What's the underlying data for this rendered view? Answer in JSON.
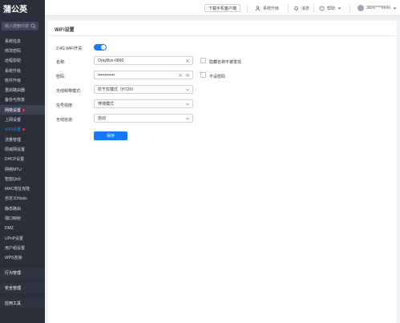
{
  "sidebar": {
    "logo": "蒲公英",
    "search_placeholder": "输入搜索内容",
    "items": [
      {
        "label": "系统信息",
        "kind": "item"
      },
      {
        "label": "修改密码",
        "kind": "item"
      },
      {
        "label": "远程协助",
        "kind": "item"
      },
      {
        "label": "系统升级",
        "kind": "item"
      },
      {
        "label": "软件升级",
        "kind": "item"
      },
      {
        "label": "重启路由器",
        "kind": "item"
      },
      {
        "label": "备份与恢复",
        "kind": "item"
      },
      {
        "label": "网络设置",
        "kind": "active-group",
        "badge": true
      },
      {
        "label": "上网设置",
        "kind": "item"
      },
      {
        "label": "WiFi设置",
        "kind": "active",
        "badge": true
      },
      {
        "label": "流量管理",
        "kind": "item"
      },
      {
        "label": "局域网设置",
        "kind": "item"
      },
      {
        "label": "DHCP设置",
        "kind": "item"
      },
      {
        "label": "网络MTU",
        "kind": "item"
      },
      {
        "label": "智能QoS",
        "kind": "item"
      },
      {
        "label": "MAC地址克隆",
        "kind": "item"
      },
      {
        "label": "自定义Hosts",
        "kind": "item"
      },
      {
        "label": "静态路由",
        "kind": "item"
      },
      {
        "label": "端口映射",
        "kind": "item"
      },
      {
        "label": "DMZ",
        "kind": "item"
      },
      {
        "label": "UPnP设置",
        "kind": "item"
      },
      {
        "label": "用户组设置",
        "kind": "item"
      },
      {
        "label": "WPS连接",
        "kind": "item"
      },
      {
        "label": "行为管理",
        "kind": "section"
      },
      {
        "label": "安全管理",
        "kind": "section"
      },
      {
        "label": "应用工具",
        "kind": "section"
      }
    ]
  },
  "topbar": {
    "download_label": "下载手机客户端",
    "upgrade_label": "系统升级",
    "messages_label": "消息",
    "help_label": "帮助",
    "account_label": "3606****6606"
  },
  "panel": {
    "title": "WiFi设置",
    "wifi_switch_label": "2.4G WiFi开关:",
    "wifi_switch_on": true,
    "name_label": "名称:",
    "name_value": "OrayBox-6890",
    "hide_name_label": "隐藏名称不被发现",
    "password_label": "密码:",
    "password_value": "••••••••••••",
    "no_password_label": "不设密码",
    "mode_label": "无线频带模式:",
    "mode_value": "抗干扰模式（HT20）",
    "signal_label": "信号强度:",
    "signal_value": "穿墙模式",
    "channel_label": "无线信道:",
    "channel_value": "自动",
    "save_label": "保存"
  },
  "colors": {
    "accent": "#1677ff",
    "sidebar_bg": "#2b2f3a"
  }
}
